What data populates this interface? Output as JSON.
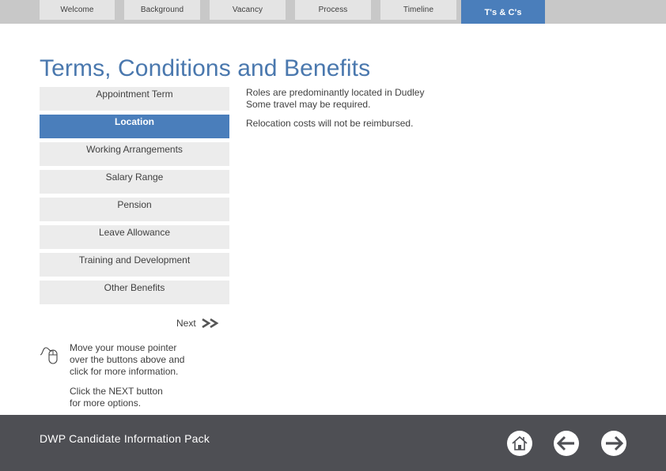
{
  "nav": {
    "tabs": [
      {
        "label": "Welcome",
        "active": false
      },
      {
        "label": "Background",
        "active": false
      },
      {
        "label": "Vacancy",
        "active": false
      },
      {
        "label": "Process",
        "active": false
      },
      {
        "label": "Timeline",
        "active": false
      },
      {
        "label": "T's & C's",
        "active": true
      }
    ]
  },
  "page": {
    "title": "Terms, Conditions and Benefits"
  },
  "sidebar": {
    "items": [
      {
        "label": "Appointment Term",
        "active": false
      },
      {
        "label": "Location",
        "active": true
      },
      {
        "label": "Working Arrangements",
        "active": false
      },
      {
        "label": "Salary Range",
        "active": false
      },
      {
        "label": "Pension",
        "active": false
      },
      {
        "label": "Leave Allowance",
        "active": false
      },
      {
        "label": "Training and Development",
        "active": false
      },
      {
        "label": "Other Benefits",
        "active": false
      }
    ]
  },
  "content": {
    "line1": "Roles are predominantly located in Dudley",
    "line2": "Some travel may be required.",
    "line3": "Relocation costs will not be reimbursed."
  },
  "next": {
    "label": "Next",
    "icon": "double-chevron-right-icon"
  },
  "hint": {
    "icon": "mouse-icon",
    "line1": "Move your mouse pointer",
    "line2": "over the buttons above and",
    "line3": "click for more information.",
    "line4": "Click the NEXT button",
    "line5": "for more options."
  },
  "footer": {
    "title": "DWP Candidate Information Pack",
    "buttons": [
      {
        "icon": "home-icon",
        "label": "Home"
      },
      {
        "icon": "arrow-left-icon",
        "label": "Back"
      },
      {
        "icon": "arrow-right-icon",
        "label": "Forward"
      }
    ]
  },
  "colors": {
    "accent": "#4a7ebb",
    "title": "#4a78ae",
    "footer_bg": "#4e4f54",
    "tab_bg": "#e4e4e4",
    "topbar_bg": "#c8c8c8",
    "button_bg": "#ececec"
  }
}
